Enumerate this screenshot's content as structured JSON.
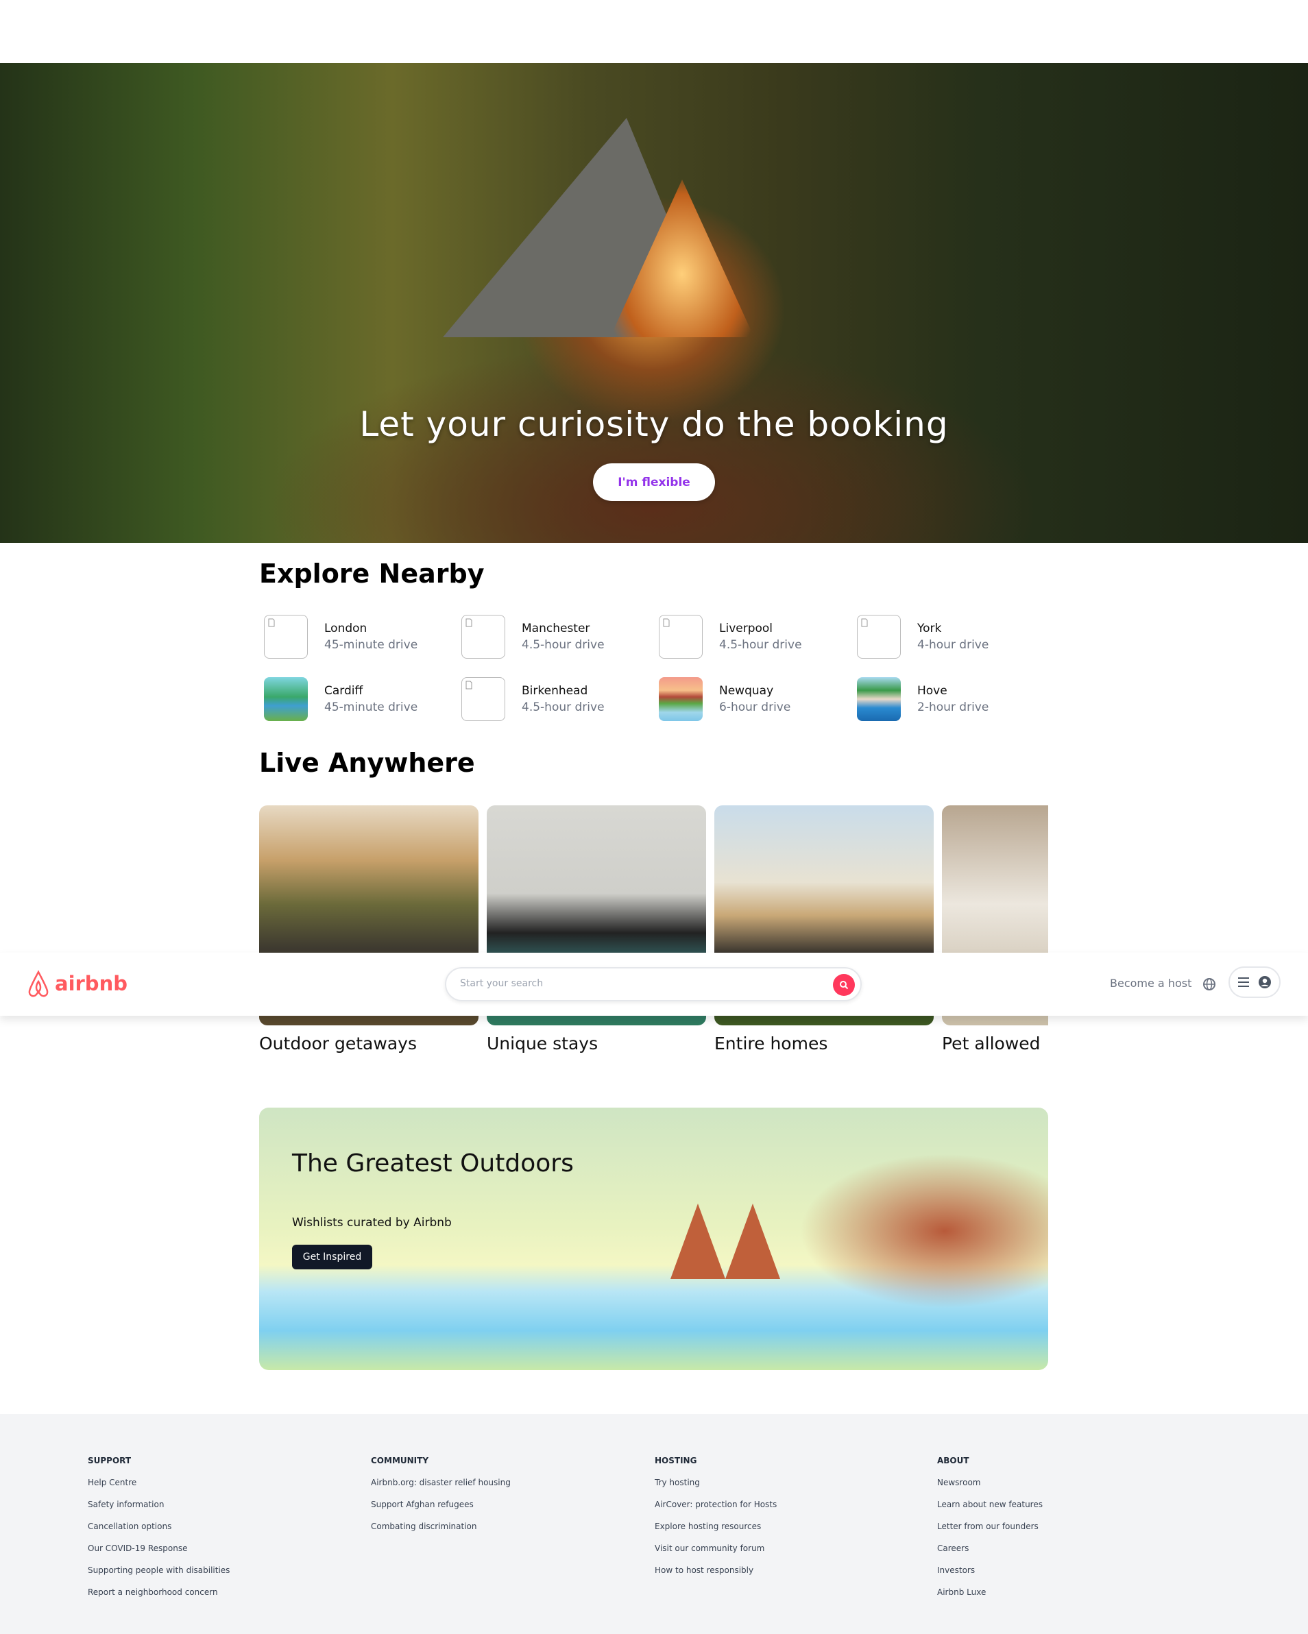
{
  "hero": {
    "title": "Let your curiosity do the booking",
    "button": "I'm flexible"
  },
  "nearby": {
    "heading": "Explore Nearby",
    "items": [
      {
        "city": "London",
        "distance": "45-minute drive",
        "image": "broken"
      },
      {
        "city": "Manchester",
        "distance": "4.5-hour drive",
        "image": "broken"
      },
      {
        "city": "Liverpool",
        "distance": "4.5-hour drive",
        "image": "broken"
      },
      {
        "city": "York",
        "distance": "4-hour drive",
        "image": "broken"
      },
      {
        "city": "Cardiff",
        "distance": "45-minute drive",
        "image": "waterfall-illustration"
      },
      {
        "city": "Birkenhead",
        "distance": "4.5-hour drive",
        "image": "broken"
      },
      {
        "city": "Newquay",
        "distance": "6-hour drive",
        "image": "seaside-town-illustration"
      },
      {
        "city": "Hove",
        "distance": "2-hour drive",
        "image": "harbour-illustration"
      }
    ]
  },
  "live": {
    "heading": "Live Anywhere",
    "cards": [
      {
        "label": "Outdoor getaways"
      },
      {
        "label": "Unique stays"
      },
      {
        "label": "Entire homes"
      },
      {
        "label": "Pet allowed"
      }
    ]
  },
  "header": {
    "logo": "airbnb",
    "search_placeholder": "Start your search",
    "become_host": "Become a host",
    "brand_color": "#ff385c"
  },
  "banner": {
    "title": "The Greatest Outdoors",
    "subtitle": "Wishlists curated by Airbnb",
    "button": "Get Inspired"
  },
  "footer": {
    "columns": [
      {
        "heading": "SUPPORT",
        "links": [
          "Help Centre",
          "Safety information",
          "Cancellation options",
          "Our COVID-19 Response",
          "Supporting people with disabilities",
          "Report a neighborhood concern"
        ]
      },
      {
        "heading": "COMMUNITY",
        "links": [
          "Airbnb.org: disaster relief housing",
          "Support Afghan refugees",
          "Combating discrimination"
        ]
      },
      {
        "heading": "HOSTING",
        "links": [
          "Try hosting",
          "AirCover: protection for Hosts",
          "Explore hosting resources",
          "Visit our community forum",
          "How to host responsibly"
        ]
      },
      {
        "heading": "ABOUT",
        "links": [
          "Newsroom",
          "Learn about new features",
          "Letter from our founders",
          "Careers",
          "Investors",
          "Airbnb Luxe"
        ]
      }
    ]
  }
}
